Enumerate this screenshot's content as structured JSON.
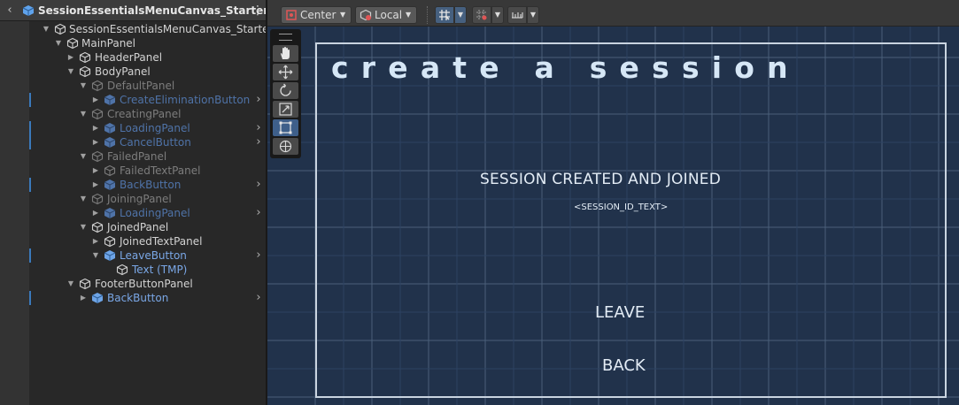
{
  "hierarchy": {
    "title": "SessionEssentialsMenuCanvas_Starter",
    "rows": [
      {
        "label": "SessionEssentialsMenuCanvas_Starter",
        "style": "normal"
      },
      {
        "label": "MainPanel",
        "style": "normal"
      },
      {
        "label": "HeaderPanel",
        "style": "normal"
      },
      {
        "label": "BodyPanel",
        "style": "normal"
      },
      {
        "label": "DefaultPanel",
        "style": "inactive"
      },
      {
        "label": "CreateEliminationButton",
        "style": "prefab-dim"
      },
      {
        "label": "CreatingPanel",
        "style": "inactive"
      },
      {
        "label": "LoadingPanel",
        "style": "prefab-dim"
      },
      {
        "label": "CancelButton",
        "style": "prefab-dim"
      },
      {
        "label": "FailedPanel",
        "style": "inactive"
      },
      {
        "label": "FailedTextPanel",
        "style": "inactive"
      },
      {
        "label": "BackButton",
        "style": "prefab-dim"
      },
      {
        "label": "JoiningPanel",
        "style": "inactive"
      },
      {
        "label": "LoadingPanel",
        "style": "prefab-dim"
      },
      {
        "label": "JoinedPanel",
        "style": "normal"
      },
      {
        "label": "JoinedTextPanel",
        "style": "normal"
      },
      {
        "label": "LeaveButton",
        "style": "prefab"
      },
      {
        "label": "Text (TMP)",
        "style": "prefab"
      },
      {
        "label": "FooterButtonPanel",
        "style": "normal"
      },
      {
        "label": "BackButton",
        "style": "prefab"
      }
    ]
  },
  "toolbar": {
    "pivot_label": "Center",
    "space_label": "Local"
  },
  "canvas": {
    "title": "create a session",
    "status": "SESSION CREATED AND JOINED",
    "session_id": "<SESSION_ID_TEXT>",
    "leave_label": "LEAVE",
    "back_label": "BACK"
  },
  "colors": {
    "panel_bg": "#282828",
    "scene_bg": "#21324b",
    "prefab_blue": "#7aa7e6",
    "selection_blue": "#3a79bb"
  },
  "icons": [
    "back-chevron-icon",
    "prefab-cube-icon",
    "gameobject-cube-icon",
    "kebab-menu-icon",
    "hand-tool-icon",
    "move-tool-icon",
    "rotate-tool-icon",
    "scale-tool-icon",
    "rect-tool-icon",
    "transform-tool-icon",
    "grid-snap-icon",
    "increment-snap-icon",
    "ruler-icon"
  ]
}
